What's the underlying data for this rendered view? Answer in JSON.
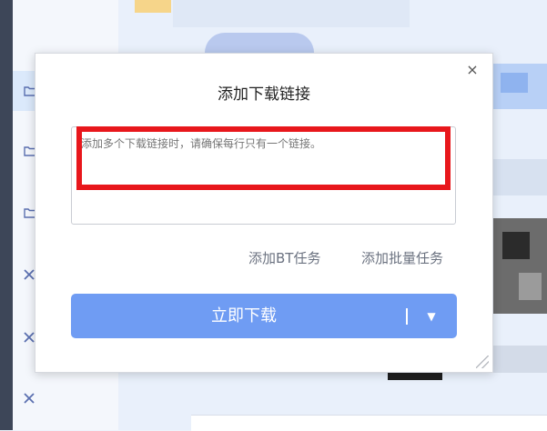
{
  "dialog": {
    "title": "添加下载链接",
    "close_symbol": "×",
    "input_placeholder": "添加多个下载链接时，请确保每行只有一个链接。",
    "link_bt": "添加BT任务",
    "link_batch": "添加批量任务",
    "download_label": "立即下载",
    "dropdown_symbol": "▼",
    "highlight_color": "#e8171c",
    "accent_color": "#6f9cf3"
  },
  "sidebar_icons": [
    "folder-icon",
    "folder-icon",
    "folder-icon",
    "close-icon",
    "close-icon",
    "close-icon"
  ]
}
